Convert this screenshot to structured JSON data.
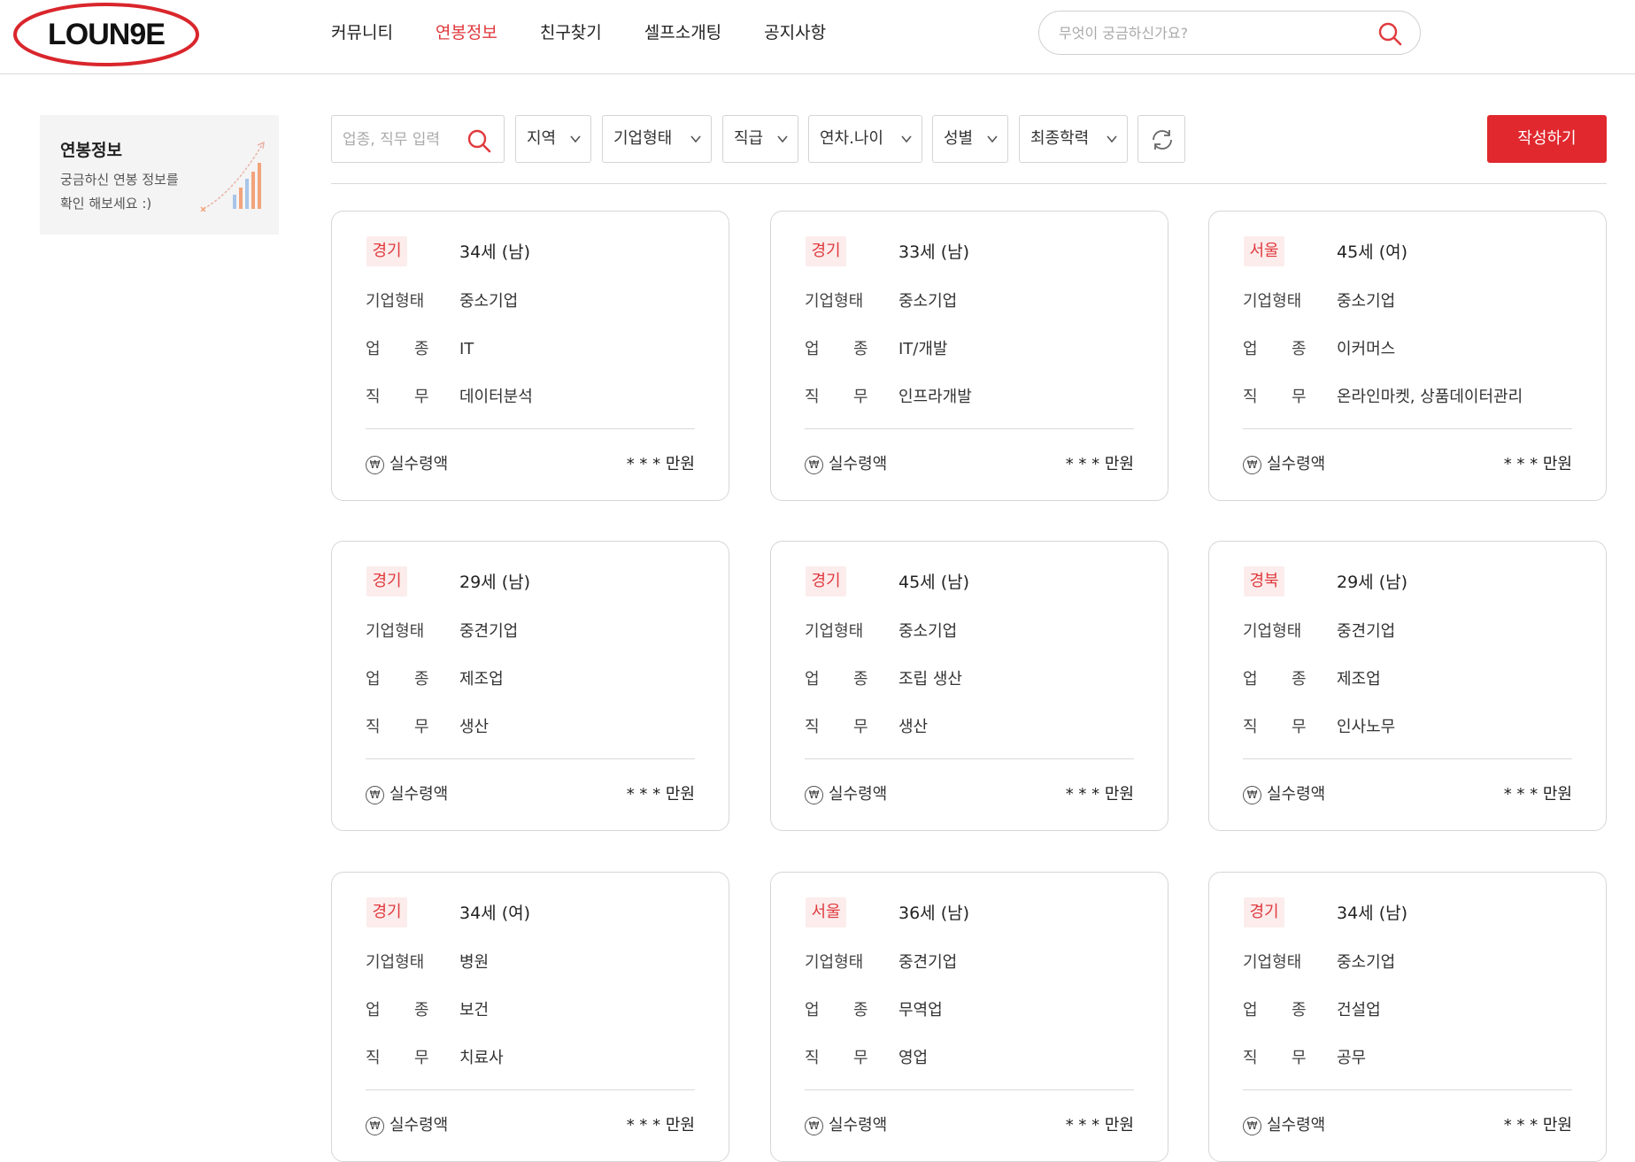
{
  "header": {
    "logo_text": "LOUN9E",
    "nav": [
      "커뮤니티",
      "연봉정보",
      "친구찾기",
      "셀프소개팅",
      "공지사항"
    ],
    "active_nav": "연봉정보",
    "search_placeholder": "무엇이 궁금하신가요?"
  },
  "sidebar": {
    "title": "연봉정보",
    "desc_line1": "궁금하신 연봉 정보를",
    "desc_line2": "확인 해보세요 :)"
  },
  "filters": {
    "keyword_placeholder": "업종, 직무 입력",
    "region": "지역",
    "company_type": "기업형태",
    "position": "직급",
    "years_age": "연차.나이",
    "gender": "성별",
    "education": "최종학력",
    "write_button": "작성하기"
  },
  "labels": {
    "company_type": "기업형태",
    "industry_a": "업",
    "industry_b": "종",
    "duty_a": "직",
    "duty_b": "무",
    "net_pay": "실수령액",
    "won_symbol": "₩"
  },
  "colors": {
    "accent": "#e03a3e",
    "button": "#e0282e"
  },
  "cards": [
    {
      "region": "경기",
      "age": "34세 (남)",
      "company_type": "중소기업",
      "industry": "IT",
      "duty": "데이터분석",
      "amount": "* * * 만원"
    },
    {
      "region": "경기",
      "age": "33세 (남)",
      "company_type": "중소기업",
      "industry": "IT/개발",
      "duty": "인프라개발",
      "amount": "* * * 만원"
    },
    {
      "region": "서울",
      "age": "45세 (여)",
      "company_type": "중소기업",
      "industry": "이커머스",
      "duty": "온라인마켓, 상품데이터관리",
      "amount": "* * * 만원"
    },
    {
      "region": "경기",
      "age": "29세 (남)",
      "company_type": "중견기업",
      "industry": "제조업",
      "duty": "생산",
      "amount": "* * * 만원"
    },
    {
      "region": "경기",
      "age": "45세 (남)",
      "company_type": "중소기업",
      "industry": "조립 생산",
      "duty": "생산",
      "amount": "* * * 만원"
    },
    {
      "region": "경북",
      "age": "29세 (남)",
      "company_type": "중견기업",
      "industry": "제조업",
      "duty": "인사노무",
      "amount": "* * * 만원"
    },
    {
      "region": "경기",
      "age": "34세 (여)",
      "company_type": "병원",
      "industry": "보건",
      "duty": "치료사",
      "amount": "* * * 만원"
    },
    {
      "region": "서울",
      "age": "36세 (남)",
      "company_type": "중견기업",
      "industry": "무역업",
      "duty": "영업",
      "amount": "* * * 만원"
    },
    {
      "region": "경기",
      "age": "34세 (남)",
      "company_type": "중소기업",
      "industry": "건설업",
      "duty": "공무",
      "amount": "* * * 만원"
    }
  ]
}
